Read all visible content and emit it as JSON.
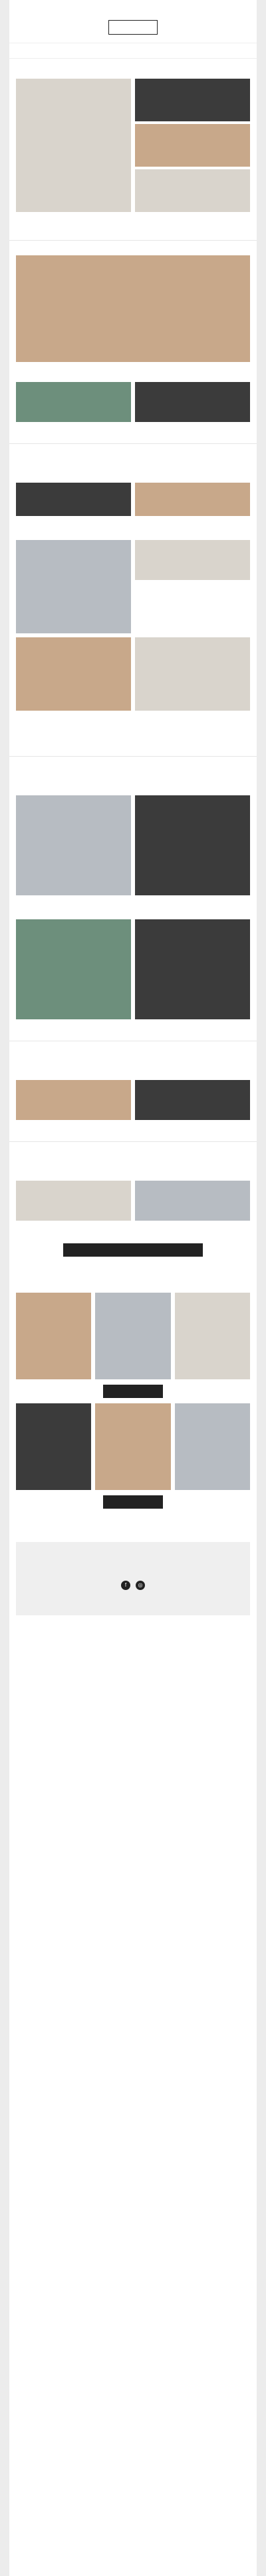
{
  "topbar": {
    "browser_link": ""
  },
  "header": {
    "logo": ""
  },
  "nav": {
    "items": [
      "",
      "",
      "",
      ""
    ]
  },
  "hero": {
    "title": "",
    "subtitle": "",
    "intro": "",
    "body": "",
    "signature": "",
    "signature_name": ""
  },
  "section1": {
    "title": "",
    "caption_main": "",
    "caption_credit": "",
    "item1": "",
    "item2": "",
    "item1_sub": "",
    "item2_sub": ""
  },
  "section2": {
    "title": "",
    "intro": "",
    "item1": "",
    "item2": "",
    "item3": "",
    "item4": "",
    "item5": ""
  },
  "section3": {
    "title": "",
    "intro": "",
    "item1": "",
    "item2": "",
    "item3": ""
  },
  "section4": {
    "title": "",
    "intro": "",
    "item1": "",
    "item2": ""
  },
  "section5": {
    "title": "",
    "intro": "",
    "item1": "",
    "item2": "",
    "cta": ""
  },
  "fashion": {
    "title": "",
    "subtitle": "",
    "cta_women": "",
    "cta_men": ""
  },
  "footer_links": {
    "link1": "",
    "link2": ""
  },
  "contact": {
    "title": "",
    "phone": "",
    "hours": ""
  },
  "legal": {
    "line1": "",
    "line2": "",
    "line3": "",
    "line4": "",
    "line5": ""
  }
}
